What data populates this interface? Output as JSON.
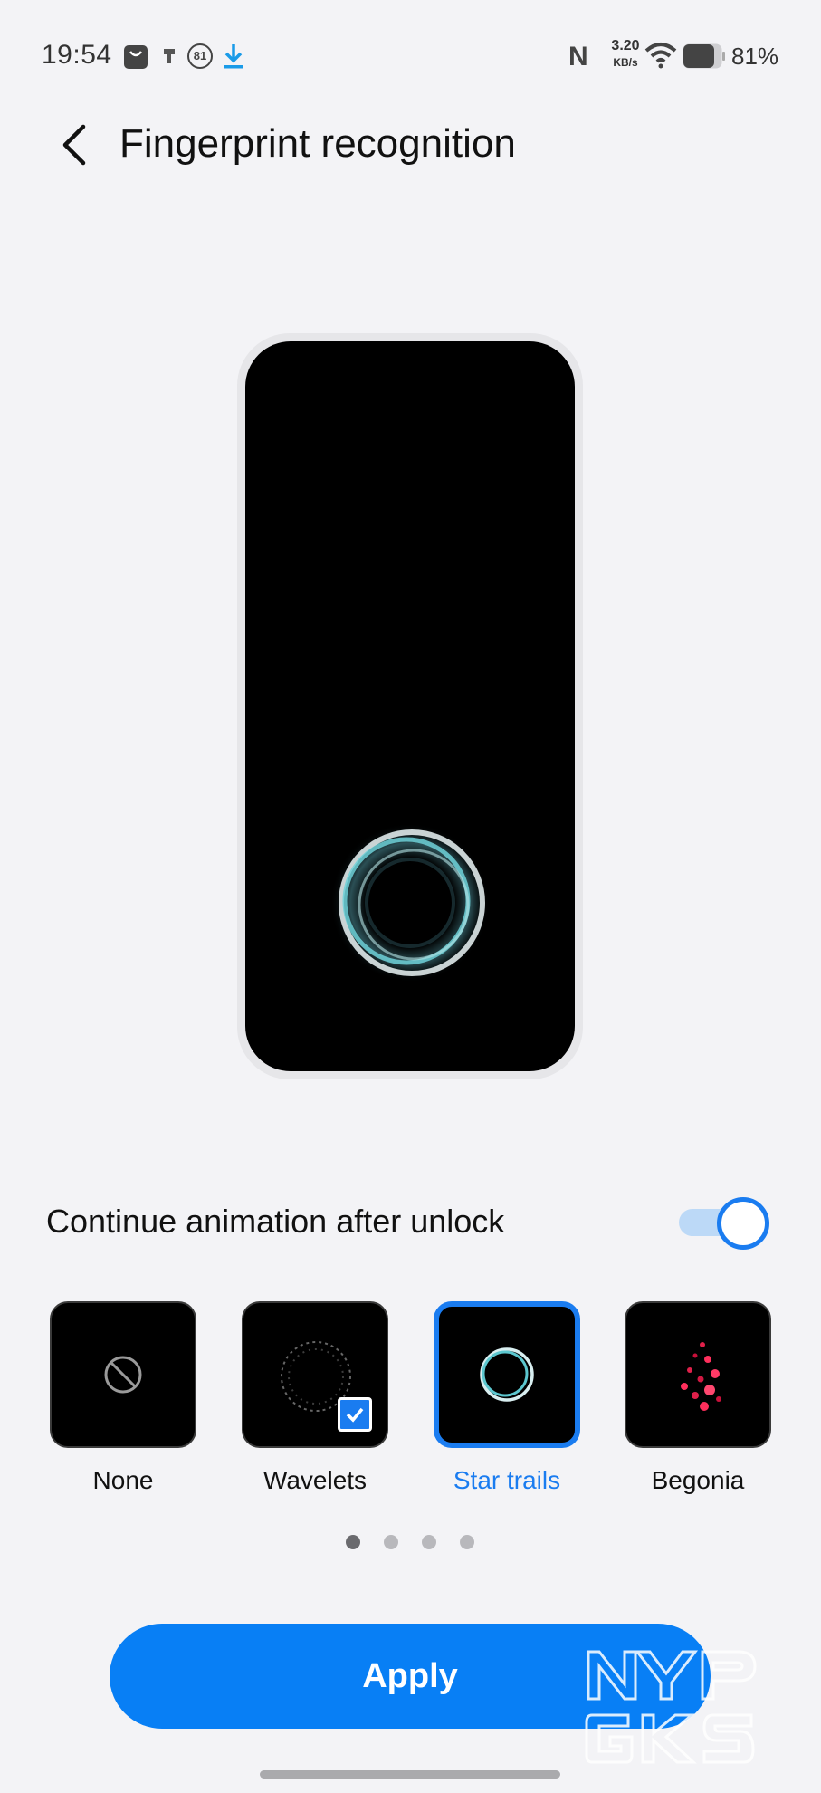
{
  "status_bar": {
    "time": "19:54",
    "icons_left": [
      "shopping-bag-icon",
      "usb-debug-icon",
      "notification-count-icon",
      "download-icon"
    ],
    "notification_count": "81",
    "nfc": "N",
    "net_speed_value": "3.20",
    "net_speed_unit": "KB/s",
    "battery_percent": "81%",
    "battery_level": 0.81
  },
  "header": {
    "title": "Fingerprint recognition",
    "back_icon": "chevron-left-icon"
  },
  "preview": {
    "animation": "star-trails-ring"
  },
  "options": {
    "continue_animation_label": "Continue animation after unlock",
    "continue_animation_on": true
  },
  "styles": [
    {
      "name": "None",
      "selected": false,
      "checked": false,
      "icon": "no-symbol-icon"
    },
    {
      "name": "Wavelets",
      "selected": false,
      "checked": true,
      "icon": "wavelets-preview"
    },
    {
      "name": "Star trails",
      "selected": true,
      "checked": false,
      "icon": "star-trails-preview"
    },
    {
      "name": "Begonia",
      "selected": false,
      "checked": false,
      "icon": "begonia-preview"
    }
  ],
  "pagination": {
    "pages": 4,
    "current": 1
  },
  "apply_label": "Apply",
  "watermark_text": "NYPGKS",
  "colors": {
    "accent": "#087ff5",
    "background": "#f3f3f6",
    "selected_text": "#1a7cf0"
  }
}
